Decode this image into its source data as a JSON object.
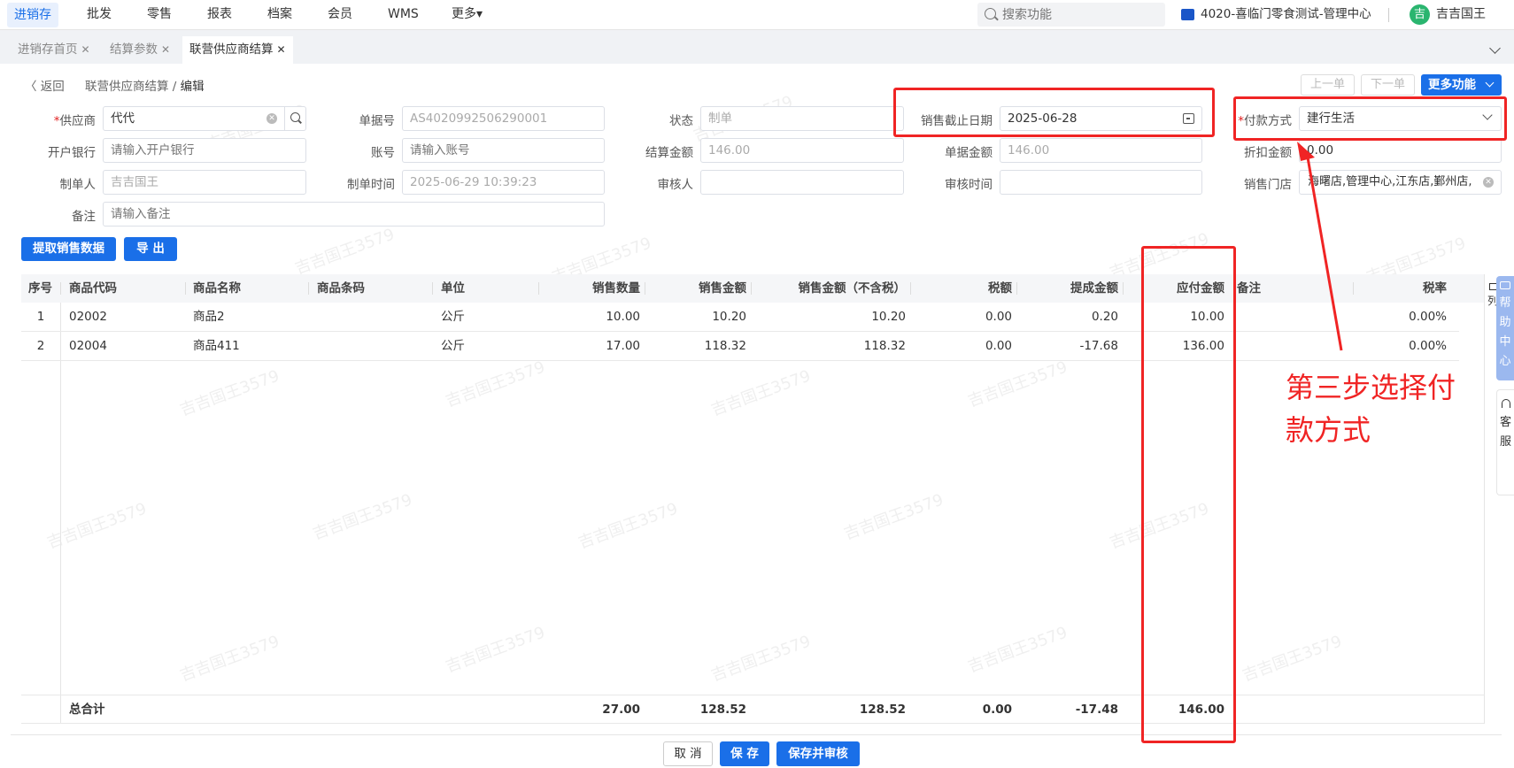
{
  "topnav": {
    "menus": [
      "进销存",
      "批发",
      "零售",
      "报表",
      "档案",
      "会员",
      "WMS",
      "更多▾"
    ],
    "search_placeholder": "搜索功能",
    "org": "4020-喜临门零食测试-管理中心",
    "avatar_char": "吉",
    "username": "吉吉国王"
  },
  "tabs": [
    {
      "label": "进销存首页",
      "close": "✕"
    },
    {
      "label": "结算参数",
      "close": "✕"
    },
    {
      "label": "联营供应商结算",
      "close": "✕"
    }
  ],
  "breadcrumb": {
    "back": "〈 返回",
    "path": "联营供应商结算",
    "sep": "/",
    "current": "编辑"
  },
  "top_buttons": {
    "prev": "上一单",
    "next": "下一单",
    "more": "更多功能"
  },
  "form": {
    "supplier": {
      "label": "供应商",
      "value": "代代"
    },
    "bank": {
      "label": "开户银行",
      "placeholder": "请输入开户银行"
    },
    "maker": {
      "label": "制单人",
      "value": "吉吉国王"
    },
    "remark": {
      "label": "备注",
      "placeholder": "请输入备注"
    },
    "doc_no": {
      "label": "单据号",
      "value": "AS4020992506290001"
    },
    "account": {
      "label": "账号",
      "placeholder": "请输入账号"
    },
    "make_time": {
      "label": "制单时间",
      "value": "2025-06-29 10:39:23"
    },
    "status": {
      "label": "状态",
      "value": "制单"
    },
    "settle_amount": {
      "label": "结算金额",
      "value": "146.00"
    },
    "auditor": {
      "label": "审核人",
      "value": ""
    },
    "sale_end_date": {
      "label": "销售截止日期",
      "value": "2025-06-28"
    },
    "doc_amount": {
      "label": "单据金额",
      "value": "146.00"
    },
    "audit_time": {
      "label": "审核时间",
      "value": ""
    },
    "pay_method": {
      "label": "付款方式",
      "value": "建行生活"
    },
    "discount": {
      "label": "折扣金额",
      "value": "0.00"
    },
    "stores": {
      "label": "销售门店",
      "value": "海曙店,管理中心,江东店,鄞州店,"
    }
  },
  "action_buttons": {
    "fetch": "提取销售数据",
    "export": "导 出"
  },
  "grid": {
    "headers": [
      "序号",
      "商品代码",
      "商品名称",
      "商品条码",
      "单位",
      "销售数量",
      "销售金额",
      "销售金额（不含税）",
      "税额",
      "提成金额",
      "应付金额",
      "备注",
      "税率"
    ],
    "rows": [
      [
        "1",
        "02002",
        "商品2",
        "",
        "公斤",
        "10.00",
        "10.20",
        "10.20",
        "0.00",
        "0.20",
        "10.00",
        "",
        "0.00%"
      ],
      [
        "2",
        "02004",
        "商品411",
        "",
        "公斤",
        "17.00",
        "118.32",
        "118.32",
        "0.00",
        "-17.68",
        "136.00",
        "",
        "0.00%"
      ]
    ],
    "total": {
      "label": "总合计",
      "qty": "27.00",
      "amount": "128.52",
      "amount_ex_tax": "128.52",
      "tax": "0.00",
      "commission": "-17.48",
      "payable": "146.00"
    }
  },
  "bottom_buttons": {
    "cancel": "取 消",
    "save": "保 存",
    "save_audit": "保存并审核"
  },
  "side": {
    "columns": "列",
    "help": [
      "帮",
      "助",
      "中",
      "心"
    ],
    "service": [
      "客",
      "服"
    ]
  },
  "annotation": {
    "text": "第三步选择付款方式"
  },
  "watermark": "吉吉国王3579",
  "colors": {
    "accent": "#1a6fe8",
    "annotation": "#f02424"
  }
}
